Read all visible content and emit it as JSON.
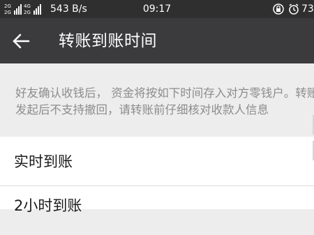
{
  "status_bar": {
    "signal_text_top": "2G",
    "signal_text_bottom": "2G",
    "net_speed": "543 B/s",
    "time": "09:17",
    "battery": "73"
  },
  "app_bar": {
    "title": "转账到账时间"
  },
  "notice": {
    "text": "好友确认收钱后， 资金将按如下时间存入对方零钱户。转账发起后不支持撤回，请转账前仔细核对收款人信息"
  },
  "options": [
    {
      "label": "实时到账"
    },
    {
      "label": "2小时到账"
    }
  ]
}
